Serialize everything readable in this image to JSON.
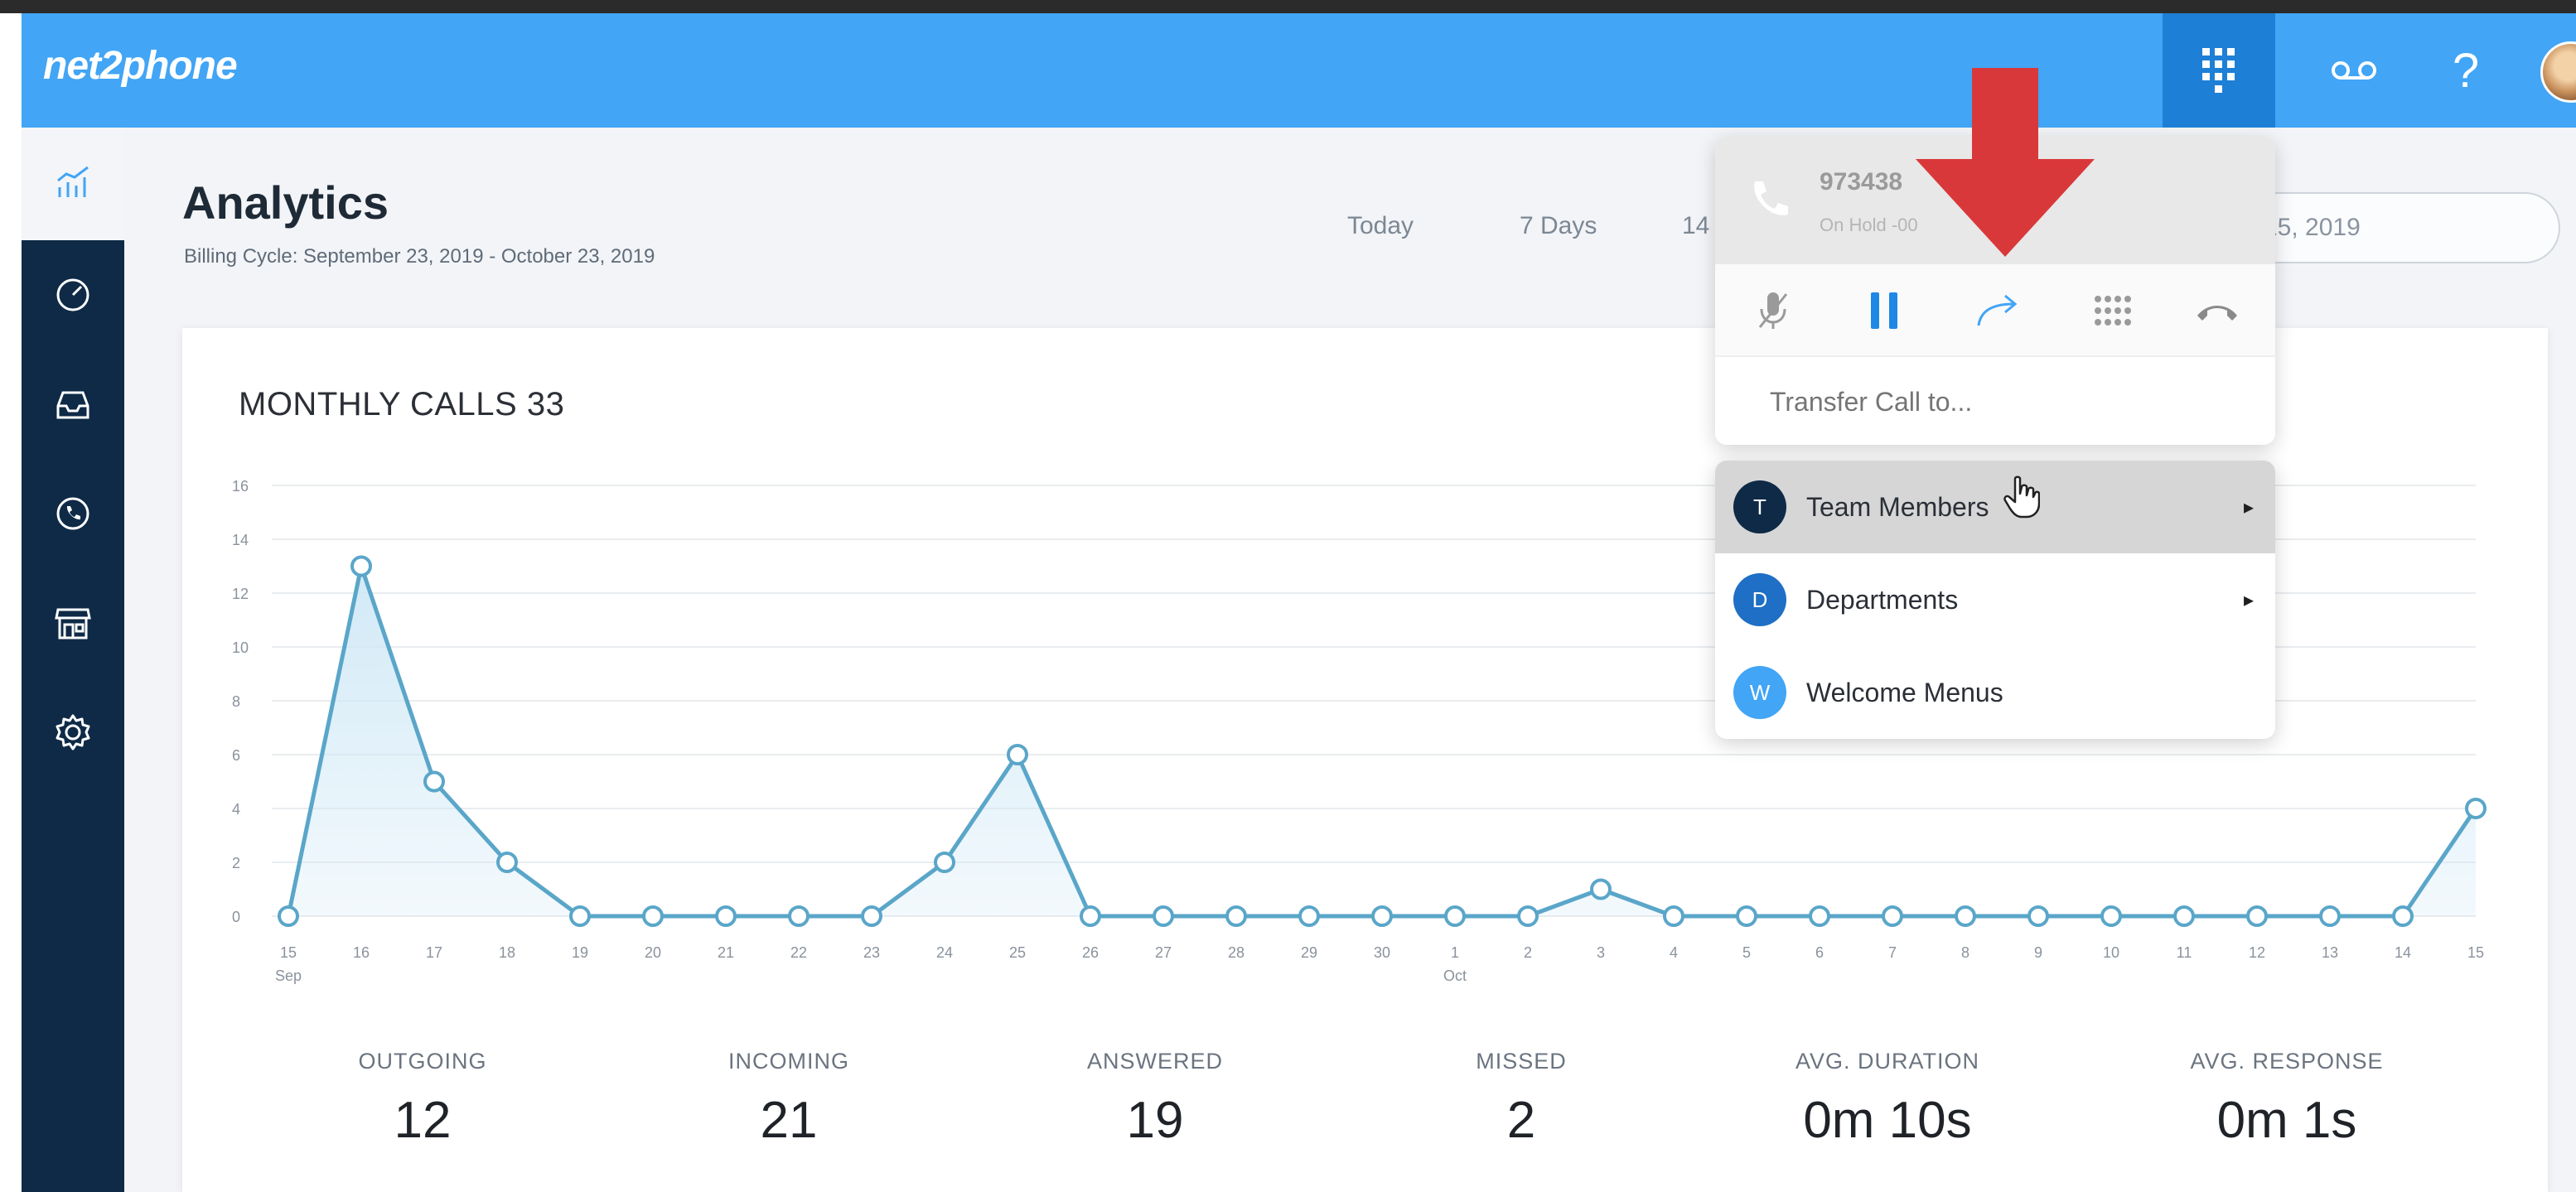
{
  "header": {
    "logo": "net2phone",
    "help_label": "?",
    "colors": {
      "bar": "#42a5f5",
      "active_button": "#1e7fd6"
    }
  },
  "sidebar": {
    "items": [
      {
        "icon": "analytics-icon",
        "active": true
      },
      {
        "icon": "dashboard-gauge-icon"
      },
      {
        "icon": "inbox-icon"
      },
      {
        "icon": "phone-icon"
      },
      {
        "icon": "store-icon"
      },
      {
        "icon": "gear-icon"
      }
    ],
    "colors": {
      "background": "#0e2a47"
    }
  },
  "page": {
    "title": "Analytics",
    "billing_cycle": "Billing Cycle: September 23, 2019 - October 23, 2019",
    "range_tabs": [
      "Today",
      "7 Days",
      "14"
    ],
    "date_picker_value": "15, 2019"
  },
  "call_widget": {
    "number": "973438",
    "status": "On Hold -00",
    "controls": [
      "mute-microphone-icon",
      "pause-icon",
      "transfer-arrow-icon",
      "dialpad-icon",
      "hang-up-icon"
    ],
    "transfer_placeholder": "Transfer Call to..."
  },
  "transfer_menu": {
    "items": [
      {
        "badge": "T",
        "label": "Team Members",
        "arrow": "▸",
        "color": "#0e2a47",
        "highlighted": true
      },
      {
        "badge": "D",
        "label": "Departments",
        "arrow": "▸",
        "color": "#1e6fc5"
      },
      {
        "badge": "W",
        "label": "Welcome Menus",
        "color": "#42a5f5"
      }
    ]
  },
  "chart_data": {
    "type": "area",
    "title": "MONTHLY CALLS 33",
    "categories": [
      "15",
      "16",
      "17",
      "18",
      "19",
      "20",
      "21",
      "22",
      "23",
      "24",
      "25",
      "26",
      "27",
      "28",
      "29",
      "30",
      "1",
      "2",
      "3",
      "4",
      "5",
      "6",
      "7",
      "8",
      "9",
      "10",
      "11",
      "12",
      "13",
      "14",
      "15"
    ],
    "month_labels": [
      {
        "index": 0,
        "label": "Sep"
      },
      {
        "index": 16,
        "label": "Oct"
      }
    ],
    "series": [
      {
        "values": [
          0,
          13,
          5,
          2,
          0,
          0,
          0,
          0,
          0,
          2,
          6,
          0,
          0,
          0,
          0,
          0,
          0,
          0,
          1,
          0,
          0,
          0,
          0,
          0,
          0,
          0,
          0,
          0,
          0,
          0,
          4
        ]
      }
    ],
    "y_ticks": [
      0,
      2,
      4,
      6,
      8,
      10,
      12,
      14,
      16
    ],
    "ylim": [
      0,
      16
    ],
    "grid": true,
    "colors": {
      "line": "#5aa6c9",
      "fill": "#cfe8f6"
    }
  },
  "stats": [
    {
      "label": "OUTGOING",
      "value": "12"
    },
    {
      "label": "INCOMING",
      "value": "21"
    },
    {
      "label": "ANSWERED",
      "value": "19"
    },
    {
      "label": "MISSED",
      "value": "2"
    },
    {
      "label": "AVG. DURATION",
      "value": "0m 10s"
    },
    {
      "label": "AVG. RESPONSE",
      "value": "0m 1s"
    }
  ]
}
